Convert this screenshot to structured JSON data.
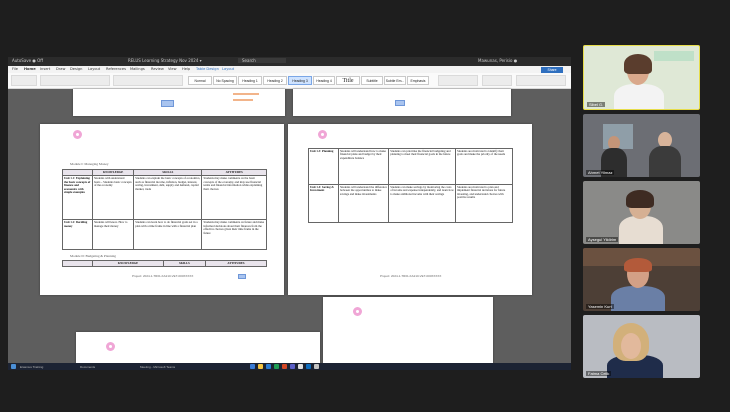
{
  "shared_window": {
    "titlebar_left": "AutoSave ● Off",
    "titlebar_center": "RELUS Learning Strategy Nov 2024 ▾",
    "titlebar_search": "Search",
    "titlebar_right": "Mawunas, Perisio ●"
  },
  "menubar": {
    "items": [
      "File",
      "Home",
      "Insert",
      "Draw",
      "Design",
      "Layout",
      "References",
      "Mailings",
      "Review",
      "View",
      "Help",
      "Table Design",
      "Layout"
    ],
    "share_label": "Share"
  },
  "ribbon": {
    "styles": [
      "Normal",
      "No Spacing",
      "Heading 1",
      "Heading 2",
      "Heading 3",
      "Heading 4",
      "Title",
      "Subtitle",
      "Subtle Em...",
      "Emphasis"
    ]
  },
  "left_page": {
    "module_title": "Module I: Managing Money",
    "headers": [
      "KNOWLEDGE",
      "SKILLS",
      "ATTITUDES"
    ],
    "rows": [
      {
        "unit": "Unit 1.1: Explaining the basic concepts of finance and economics with simple examples",
        "knowledge": "Students with understand basic... Students basic concepts of the economy",
        "skills": "Students can explain the basic concepts of economics, such as financial income, inflation, budget, interest, saving, investment, debt, supply and demand, capital market, trade",
        "attitudes": "Students may make comments on the basic concepts of the economy, and may use financial terms and financial information while explaining their choices"
      },
      {
        "unit": "Unit 1.2: Deciding money",
        "knowledge": "Students will know. How to manage their money",
        "skills": "Students can learn how to do financial goals set in a plan with a time frame in line with a financial plan",
        "attitudes": "Students may make comments on future and make informed decisions about their finances from the effective choices given their time frame in the future"
      }
    ],
    "module2_title": "Module II: Budgeting & Planning",
    "footer": "Project: 2024-1-TR01-KA210-VET-000XXXXX"
  },
  "right_page": {
    "rows": [
      {
        "unit": "Unit 1.3: Planning",
        "knowledge": "Students will understand how to make financial plans and budget by their expenditure balance",
        "skills": "Students can prioritise the financial budgeting and planning to meet their financial goals in the future",
        "attitudes": "Students are motivated to identify their goals and make the priority of the needs"
      },
      {
        "unit": "Unit 1.4: Saving & Investment",
        "knowledge": "Students will understand the difference between the opportunities to make savings and make investments",
        "skills": "Students can make savings by monitoring the costs of income and expense independently, and learn how to make additional income with their savings",
        "attitudes": "Students are motivated to plan and implement financial decisions for future investing, and understand choices with positive results"
      }
    ],
    "footer": "Project: 2024-1-TR01-KA210-VET-000XXXXX"
  },
  "taskbar": {
    "items": [
      "Erasmus Training",
      "Documents",
      "Meeting - Microsoft Teams"
    ]
  },
  "participants": [
    {
      "name": "Sibel G.",
      "active": true,
      "bg": "#dfe8d6"
    },
    {
      "name": "Ahmet Yilmaz",
      "active": false,
      "bg": "#6c6e74"
    },
    {
      "name": "Aysegul Yildirim",
      "active": false,
      "bg": "#8a8a88"
    },
    {
      "name": "Yasemin Kurt",
      "active": false,
      "bg": "#4d3f36"
    },
    {
      "name": "Fatma Celik",
      "active": false,
      "bg": "#b9bcc2"
    }
  ]
}
